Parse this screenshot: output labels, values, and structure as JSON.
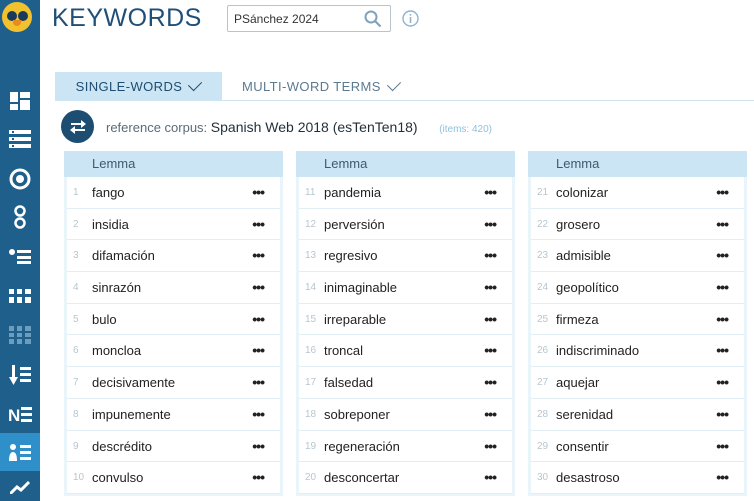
{
  "header": {
    "title": "KEYWORDS",
    "search_value": "PSánchez 2024"
  },
  "tabs": [
    {
      "label": "SINGLE-WORDS",
      "active": true
    },
    {
      "label": "MULTI-WORD TERMS",
      "active": false
    }
  ],
  "corpus": {
    "label": "reference corpus:",
    "value": "Spanish Web 2018 (esTenTen18)",
    "items": "(items: 420)"
  },
  "table_header": "Lemma",
  "columns": [
    [
      {
        "n": "1",
        "lemma": "fango"
      },
      {
        "n": "2",
        "lemma": "insidia"
      },
      {
        "n": "3",
        "lemma": "difamación"
      },
      {
        "n": "4",
        "lemma": "sinrazón"
      },
      {
        "n": "5",
        "lemma": "bulo"
      },
      {
        "n": "6",
        "lemma": "moncloa"
      },
      {
        "n": "7",
        "lemma": "decisivamente"
      },
      {
        "n": "8",
        "lemma": "impunemente"
      },
      {
        "n": "9",
        "lemma": "descrédito"
      },
      {
        "n": "10",
        "lemma": "convulso"
      }
    ],
    [
      {
        "n": "11",
        "lemma": "pandemia"
      },
      {
        "n": "12",
        "lemma": "perversión"
      },
      {
        "n": "13",
        "lemma": "regresivo"
      },
      {
        "n": "14",
        "lemma": "inimaginable"
      },
      {
        "n": "15",
        "lemma": "irreparable"
      },
      {
        "n": "16",
        "lemma": "troncal"
      },
      {
        "n": "17",
        "lemma": "falsedad"
      },
      {
        "n": "18",
        "lemma": "sobreponer"
      },
      {
        "n": "19",
        "lemma": "regeneración"
      },
      {
        "n": "20",
        "lemma": "desconcertar"
      }
    ],
    [
      {
        "n": "21",
        "lemma": "colonizar"
      },
      {
        "n": "22",
        "lemma": "grosero"
      },
      {
        "n": "23",
        "lemma": "admisible"
      },
      {
        "n": "24",
        "lemma": "geopolítico"
      },
      {
        "n": "25",
        "lemma": "firmeza"
      },
      {
        "n": "26",
        "lemma": "indiscriminado"
      },
      {
        "n": "27",
        "lemma": "aquejar"
      },
      {
        "n": "28",
        "lemma": "serenidad"
      },
      {
        "n": "29",
        "lemma": "consentir"
      },
      {
        "n": "30",
        "lemma": "desastroso"
      }
    ]
  ],
  "row_menu_label": "•••",
  "sidebar_icons": [
    "dashboard-icon",
    "list-icon",
    "target-icon",
    "nodes-icon",
    "bullet-list-icon",
    "grid-icon",
    "grid-faded-icon",
    "sort-icon",
    "ne-icon",
    "keywords-icon",
    "trend-icon"
  ],
  "colors": {
    "sidebar": "#1f5f8b",
    "accent": "#2f8fc9",
    "title": "#1f4f78",
    "tab_active": "#cbe5f4"
  }
}
